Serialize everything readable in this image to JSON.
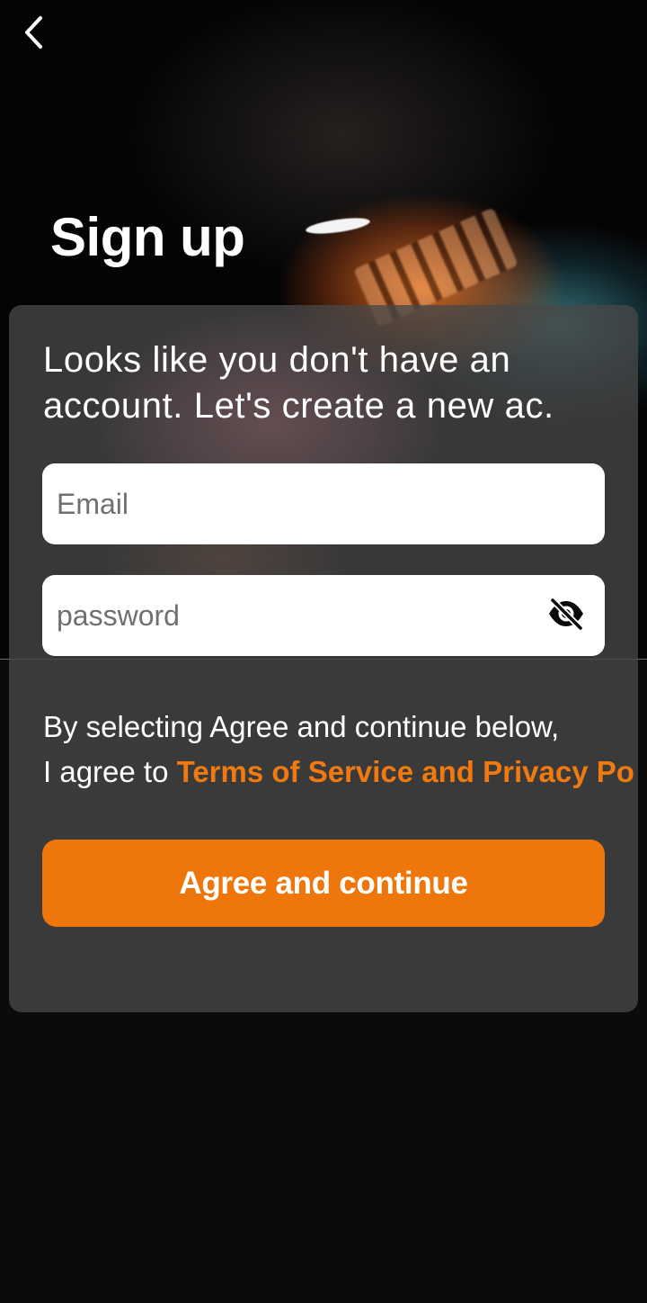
{
  "header": {
    "back_icon": "chevron-left-icon",
    "title": "Sign up"
  },
  "card": {
    "intro": "Looks like you don't have an account. Let's create a new ac.",
    "email": {
      "placeholder": "Email",
      "value": ""
    },
    "password": {
      "placeholder": "password",
      "value": "",
      "toggle_icon": "eye-off-icon"
    },
    "terms": {
      "line1": "By selecting Agree and continue below,",
      "prefix": "I agree to ",
      "link_label": "Terms of Service and Privacy Po"
    },
    "agree_label": "Agree and continue"
  },
  "colors": {
    "accent": "#ee760a",
    "link": "#f07a10",
    "background": "#0c0a0b",
    "card": "#484848"
  }
}
